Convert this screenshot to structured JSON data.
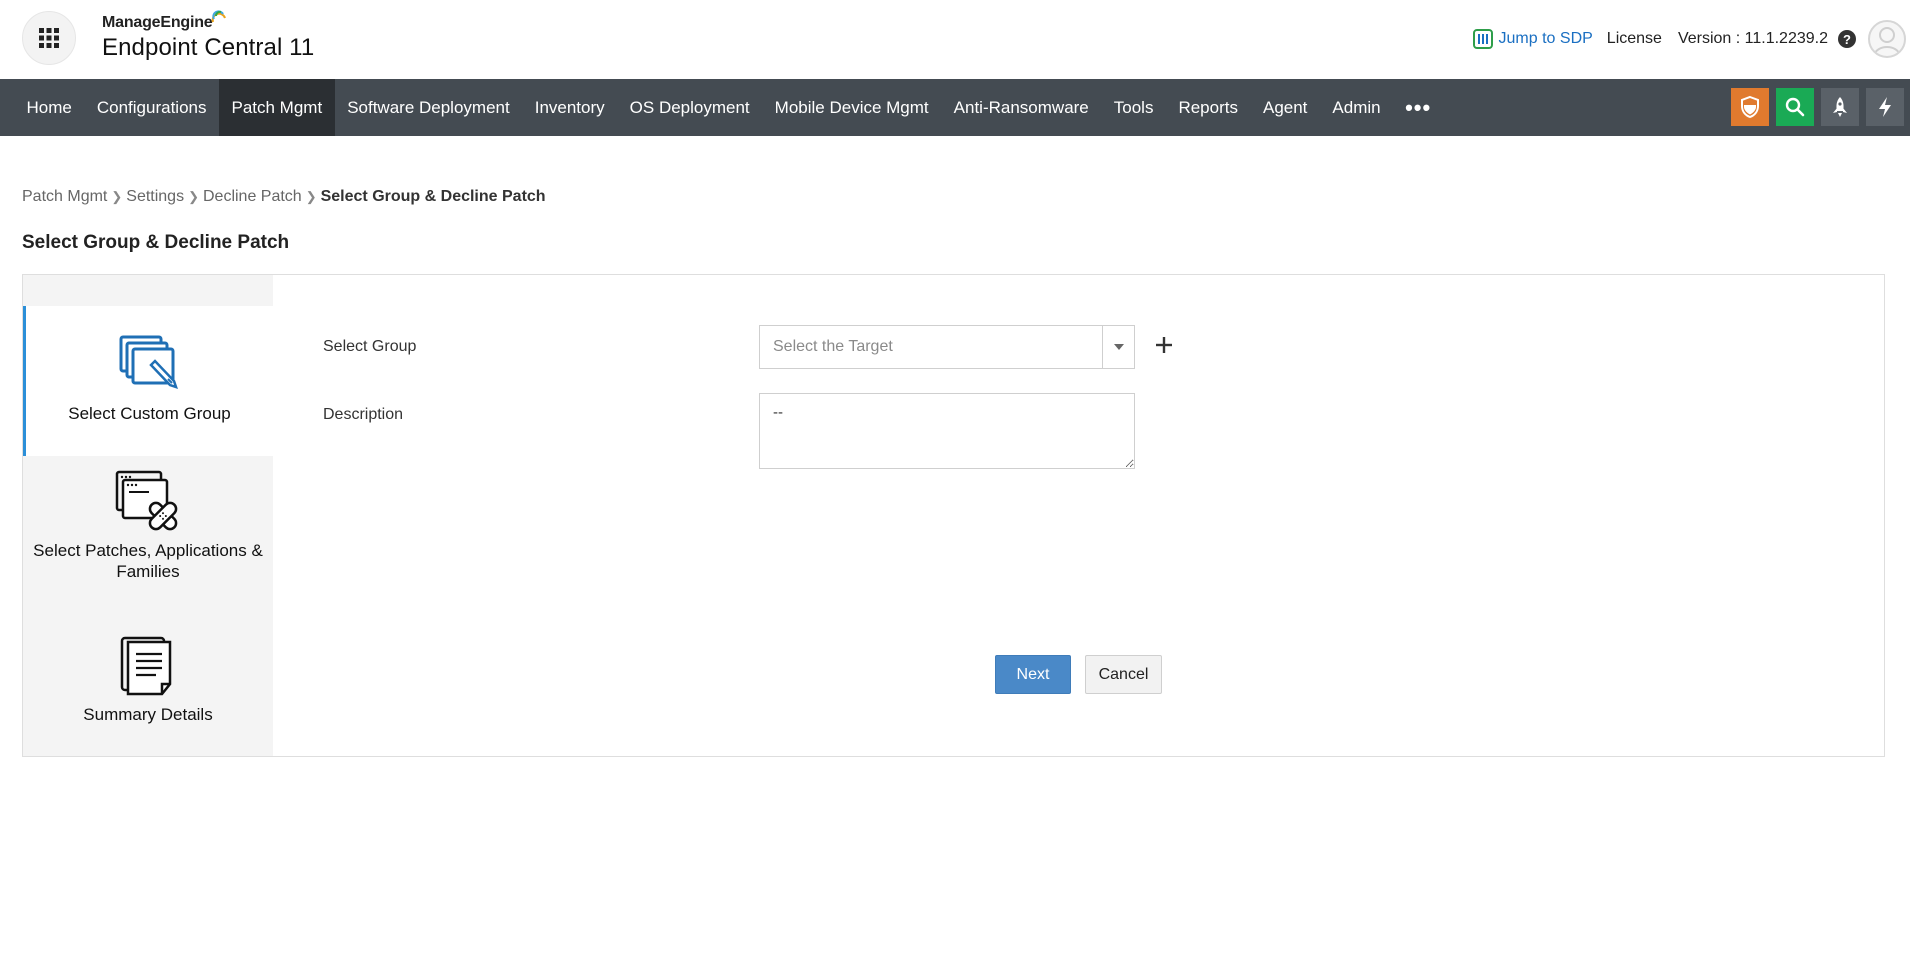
{
  "header": {
    "brand_small": "ManageEngine",
    "brand_big": "Endpoint Central 11",
    "jump_label": "Jump to SDP",
    "license_label": "License",
    "version_label": "Version : 11.1.2239.2",
    "help_label": "?"
  },
  "nav": {
    "items": [
      {
        "label": "Home"
      },
      {
        "label": "Configurations"
      },
      {
        "label": "Patch Mgmt"
      },
      {
        "label": "Software Deployment"
      },
      {
        "label": "Inventory"
      },
      {
        "label": "OS Deployment"
      },
      {
        "label": "Mobile Device Mgmt"
      },
      {
        "label": "Anti-Ransomware"
      },
      {
        "label": "Tools"
      },
      {
        "label": "Reports"
      },
      {
        "label": "Agent"
      },
      {
        "label": "Admin"
      }
    ],
    "active_index": 2,
    "more_label": "•••",
    "tool_icons": [
      {
        "icon": "shield-icon",
        "color": "#e07a2e"
      },
      {
        "icon": "search-icon",
        "color": "#1aaa55"
      },
      {
        "icon": "rocket-icon",
        "color": "#5a6168"
      },
      {
        "icon": "lightning-icon",
        "color": "#5a6168"
      }
    ]
  },
  "breadcrumb": {
    "items": [
      "Patch Mgmt",
      "Settings",
      "Decline Patch"
    ],
    "current": "Select Group & Decline Patch"
  },
  "page": {
    "title": "Select Group & Decline Patch"
  },
  "wizard": {
    "steps": [
      {
        "label": "Select Custom Group",
        "icon": "custom-group-icon"
      },
      {
        "label": "Select Patches, Applications & Families",
        "icon": "patches-icon"
      },
      {
        "label": "Summary Details",
        "icon": "summary-document-icon"
      }
    ],
    "active_step": 0,
    "form": {
      "group_label": "Select Group",
      "group_placeholder": "Select the Target",
      "description_label": "Description",
      "description_value": "--"
    },
    "buttons": {
      "next_label": "Next",
      "cancel_label": "Cancel"
    }
  },
  "colors": {
    "nav_bg": "#444b52",
    "nav_active_bg": "#2b2f33",
    "primary": "#4a89c8",
    "link": "#1a6fc2",
    "step_active_border": "#2b8fd8"
  }
}
